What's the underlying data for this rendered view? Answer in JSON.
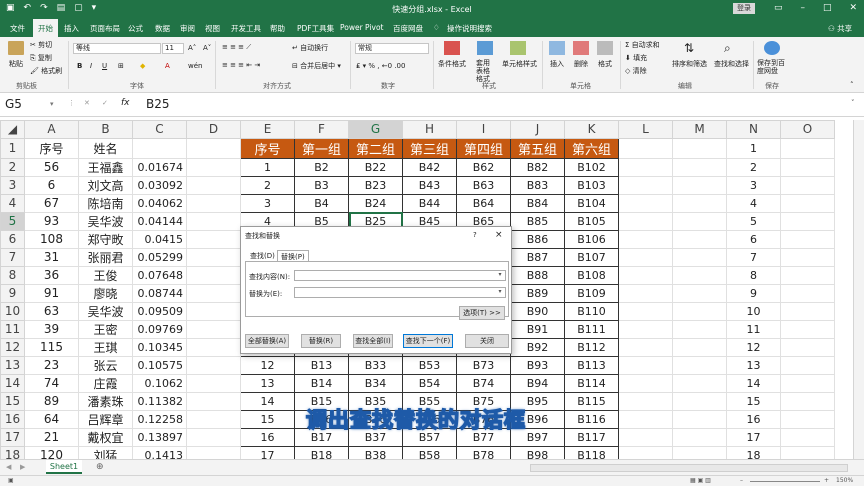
{
  "window": {
    "title": "快速分组.xlsx  -  Excel",
    "login_label": "登录",
    "share_label": "共享"
  },
  "menu": {
    "items": [
      "文件",
      "开始",
      "插入",
      "页面布局",
      "公式",
      "数据",
      "审阅",
      "视图",
      "开发工具",
      "帮助",
      "PDF工具集",
      "Power Pivot",
      "百度网盘"
    ],
    "active_index": 1,
    "tell_me": "操作说明搜索"
  },
  "ribbon": {
    "clipboard": {
      "cut": "剪切",
      "copy": "复制",
      "paint": "格式刷",
      "label": "剪贴板"
    },
    "font": {
      "name": "等线",
      "size": "11",
      "label": "字体",
      "bold": "B",
      "italic": "I",
      "underline": "U"
    },
    "align": {
      "wrap": "自动换行",
      "merge": "合并后居中",
      "label": "对齐方式"
    },
    "number": {
      "format": "常规",
      "label": "数字"
    },
    "styles": {
      "cond": "条件格式",
      "table": "套用表格格式",
      "cell": "单元格样式",
      "label": "样式"
    },
    "cells": {
      "insert": "插入",
      "delete": "删除",
      "format": "格式",
      "label": "单元格"
    },
    "edit": {
      "autosum": "自动求和",
      "fill": "填充",
      "clear": "清除",
      "sort": "排序和筛选",
      "find": "查找和选择",
      "label": "编辑"
    },
    "save": {
      "baidu": "保存到百度网盘",
      "label": "保存"
    }
  },
  "formula_bar": {
    "name_box": "G5",
    "content": "B25",
    "fx": "fx"
  },
  "columns": [
    "A",
    "B",
    "C",
    "D",
    "E",
    "F",
    "G",
    "H",
    "I",
    "J",
    "K",
    "L",
    "M",
    "N",
    "O"
  ],
  "rows": [
    {
      "n": "1",
      "a": "序号",
      "b": "姓名",
      "c": "",
      "e": "序号",
      "f": "第一组",
      "g": "第二组",
      "h": "第三组",
      "i": "第四组",
      "j": "第五组",
      "k": "第六组"
    },
    {
      "n": "2",
      "a": "56",
      "b": "王福鑫",
      "c": "0.01674",
      "e": "1",
      "f": "B2",
      "g": "B22",
      "h": "B42",
      "i": "B62",
      "j": "B82",
      "k": "B102"
    },
    {
      "n": "3",
      "a": "6",
      "b": "刘文高",
      "c": "0.03092",
      "e": "2",
      "f": "B3",
      "g": "B23",
      "h": "B43",
      "i": "B63",
      "j": "B83",
      "k": "B103"
    },
    {
      "n": "4",
      "a": "67",
      "b": "陈培南",
      "c": "0.04062",
      "e": "3",
      "f": "B4",
      "g": "B24",
      "h": "B44",
      "i": "B64",
      "j": "B84",
      "k": "B104"
    },
    {
      "n": "5",
      "a": "93",
      "b": "吴华波",
      "c": "0.04144",
      "e": "4",
      "f": "B5",
      "g": "B25",
      "h": "B45",
      "i": "B65",
      "j": "B85",
      "k": "B105"
    },
    {
      "n": "6",
      "a": "108",
      "b": "郑守畋",
      "c": "0.0415",
      "e": "",
      "f": "",
      "g": "",
      "h": "",
      "i": "",
      "j": "B86",
      "k": "B106"
    },
    {
      "n": "7",
      "a": "31",
      "b": "张丽君",
      "c": "0.05299",
      "e": "",
      "f": "",
      "g": "",
      "h": "",
      "i": "",
      "j": "B87",
      "k": "B107"
    },
    {
      "n": "8",
      "a": "36",
      "b": "王俊",
      "c": "0.07648",
      "e": "",
      "f": "",
      "g": "",
      "h": "",
      "i": "",
      "j": "B88",
      "k": "B108"
    },
    {
      "n": "9",
      "a": "91",
      "b": "廖晓",
      "c": "0.08744",
      "e": "",
      "f": "",
      "g": "",
      "h": "",
      "i": "",
      "j": "B89",
      "k": "B109"
    },
    {
      "n": "10",
      "a": "63",
      "b": "吴华波",
      "c": "0.09509",
      "e": "",
      "f": "",
      "g": "",
      "h": "",
      "i": "",
      "j": "B90",
      "k": "B110"
    },
    {
      "n": "11",
      "a": "39",
      "b": "王密",
      "c": "0.09769",
      "e": "",
      "f": "",
      "g": "",
      "h": "",
      "i": "",
      "j": "B91",
      "k": "B111"
    },
    {
      "n": "12",
      "a": "115",
      "b": "王琪",
      "c": "0.10345",
      "e": "",
      "f": "",
      "g": "",
      "h": "",
      "i": "",
      "j": "B92",
      "k": "B112"
    },
    {
      "n": "13",
      "a": "23",
      "b": "张云",
      "c": "0.10575",
      "e": "12",
      "f": "B13",
      "g": "B33",
      "h": "B53",
      "i": "B73",
      "j": "B93",
      "k": "B113"
    },
    {
      "n": "14",
      "a": "74",
      "b": "庄霞",
      "c": "0.1062",
      "e": "13",
      "f": "B14",
      "g": "B34",
      "h": "B54",
      "i": "B74",
      "j": "B94",
      "k": "B114"
    },
    {
      "n": "15",
      "a": "89",
      "b": "潘素珠",
      "c": "0.11382",
      "e": "14",
      "f": "B15",
      "g": "B35",
      "h": "B55",
      "i": "B75",
      "j": "B95",
      "k": "B115"
    },
    {
      "n": "16",
      "a": "64",
      "b": "吕辉章",
      "c": "0.12258",
      "e": "15",
      "f": "B16",
      "g": "B36",
      "h": "B56",
      "i": "B76",
      "j": "B96",
      "k": "B116"
    },
    {
      "n": "17",
      "a": "21",
      "b": "戴权宜",
      "c": "0.13897",
      "e": "16",
      "f": "B17",
      "g": "B37",
      "h": "B57",
      "i": "B77",
      "j": "B97",
      "k": "B117"
    },
    {
      "n": "18",
      "a": "120",
      "b": "刘猛",
      "c": "0.1413",
      "e": "17",
      "f": "B18",
      "g": "B38",
      "h": "B58",
      "i": "B78",
      "j": "B98",
      "k": "B118"
    }
  ],
  "dialog": {
    "title": "查找和替换",
    "help": "?",
    "close": "×",
    "tab_find": "查找(D)",
    "tab_replace": "替换(P)",
    "find_label": "查找内容(N):",
    "replace_label": "替换为(E):",
    "find_value": "",
    "replace_value": "",
    "options": "选项(T) >>",
    "replace_all": "全部替换(A)",
    "replace": "替换(R)",
    "find_all": "查找全部(I)",
    "find_next": "查找下一个(F)",
    "close_btn": "关闭"
  },
  "sheet_tab": "Sheet1",
  "zoom": "150%",
  "caption": "调出查找替换的对话框"
}
